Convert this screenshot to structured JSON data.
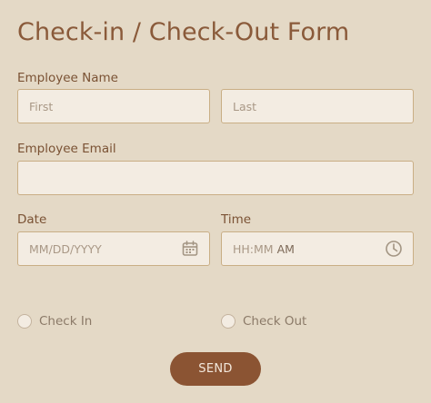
{
  "form": {
    "title": "Check-in / Check-Out Form"
  },
  "name": {
    "label": "Employee Name",
    "first_placeholder": "First",
    "last_placeholder": "Last"
  },
  "email": {
    "label": "Employee Email",
    "value": ""
  },
  "date": {
    "label": "Date",
    "placeholder": "MM/DD/YYYY",
    "icon": "calendar-icon"
  },
  "time": {
    "label": "Time",
    "placeholder_hhmm": "HH:MM",
    "placeholder_ampm": "AM",
    "icon": "clock-icon"
  },
  "options": [
    {
      "label": "Check In",
      "selected": false
    },
    {
      "label": "Check Out",
      "selected": false
    }
  ],
  "submit": {
    "label": "SEND"
  },
  "colors": {
    "background": "#e4d9c6",
    "accent": "#8b5433",
    "input_bg": "#f3ece2",
    "input_border": "#c9ae85"
  }
}
